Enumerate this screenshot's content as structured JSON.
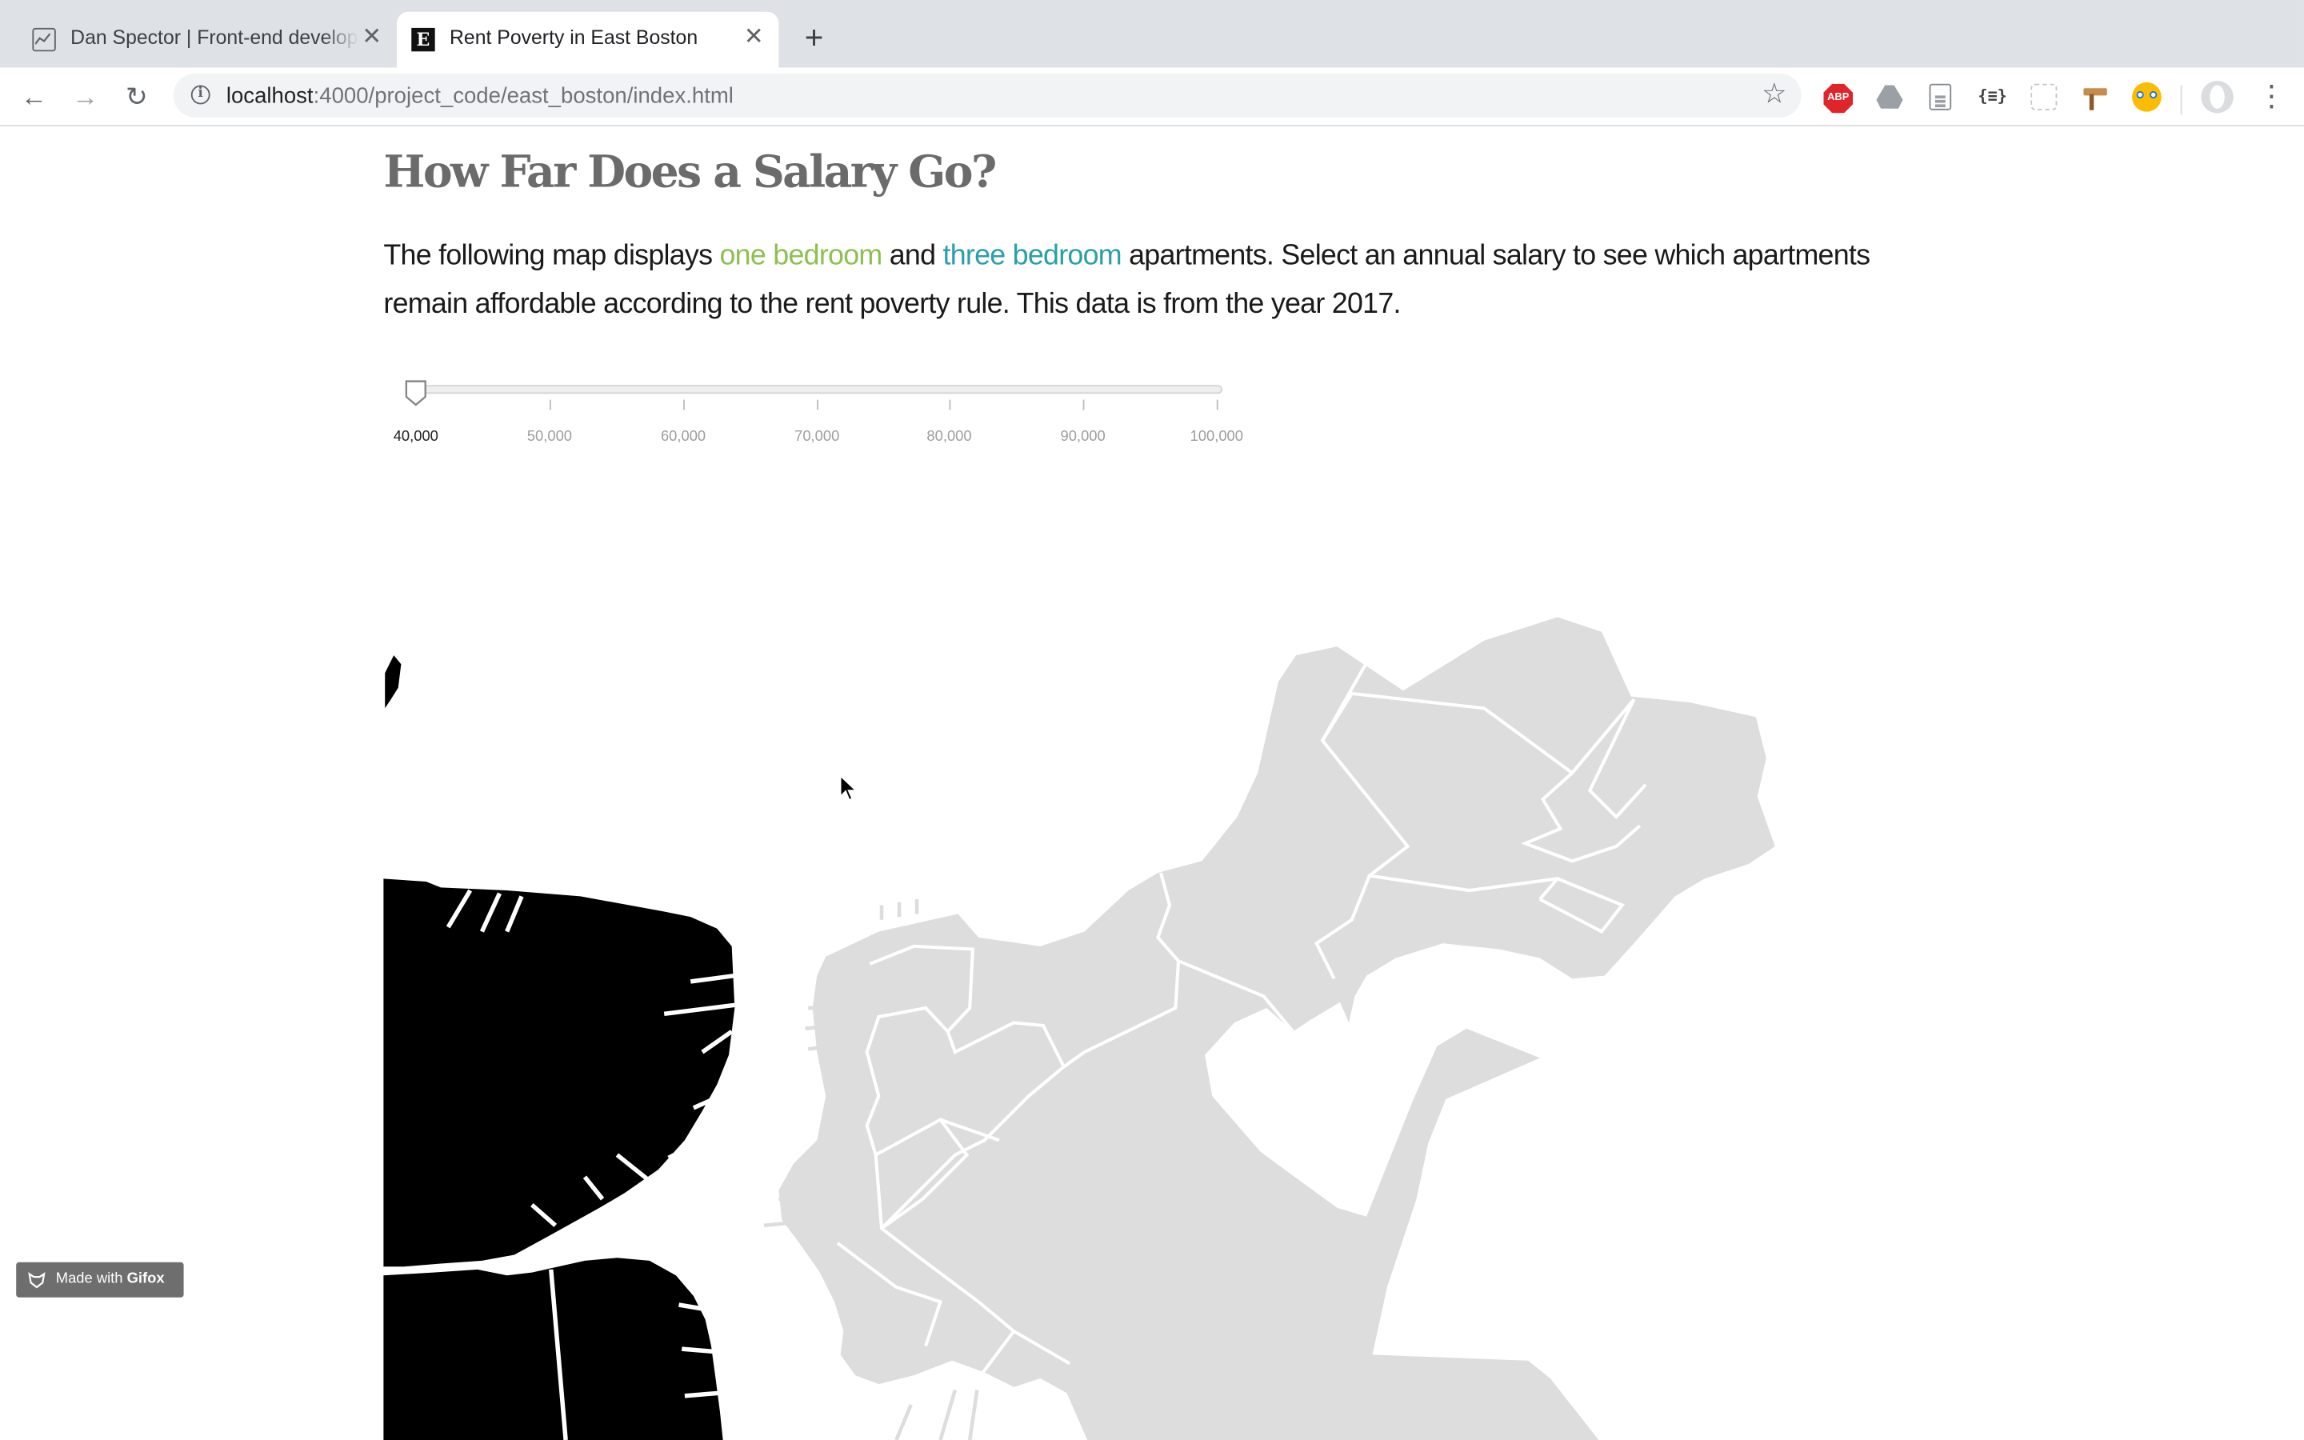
{
  "browser": {
    "tabs": [
      {
        "title": "Dan Spector | Front-end developer",
        "favicon": "image-icon",
        "active": false
      },
      {
        "title": "Rent Poverty in East Boston",
        "favicon": "e-logo",
        "active": true
      }
    ],
    "url_host": "localhost",
    "url_path": ":4000/project_code/east_boston/index.html",
    "extensions": [
      "adblock-plus-icon",
      "google-drive-icon",
      "document-icon",
      "json-viewer-icon",
      "grid-icon",
      "hammer-icon",
      "owl-icon"
    ],
    "abp_label": "ABP",
    "json_label": "{≡}"
  },
  "page": {
    "heading": "How Far Does a Salary Go?",
    "intro_prefix": "The following map displays ",
    "one_bedroom": "one bedroom",
    "intro_and": " and ",
    "three_bedroom": "three bedroom",
    "intro_suffix": " apartments. Select an annual salary to see which apartments remain affordable according to the rent poverty rule. This data is from the year 2017.",
    "colors": {
      "one_bedroom": "#8cc152",
      "three_bedroom": "#2a9faa",
      "heading": "#6b6b6b"
    }
  },
  "slider": {
    "labels": [
      "40,000",
      "50,000",
      "60,000",
      "70,000",
      "80,000",
      "90,000",
      "100,000"
    ],
    "selected": "40,000"
  },
  "map": {
    "boston_color": "#000000",
    "east_boston_color": "#dddddd",
    "east_boston_outline": "#ffffff"
  },
  "badge": {
    "prefix": "Made with ",
    "brand": "Gifox"
  }
}
